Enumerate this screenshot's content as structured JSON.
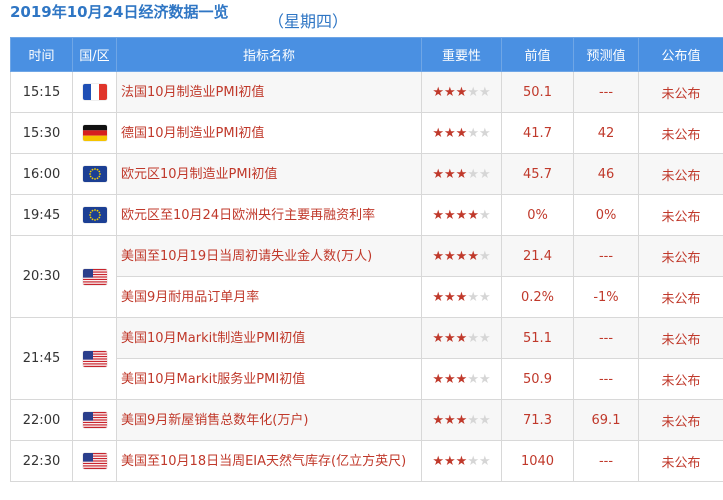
{
  "header": {
    "title": "2019年10月24日经济数据一览",
    "weekday": "（星期四）"
  },
  "columns": [
    "时间",
    "国/区",
    "指标名称",
    "重要性",
    "前值",
    "预测值",
    "公布值"
  ],
  "rows": [
    {
      "time": "15:15",
      "country": "fr",
      "name": "法国10月制造业PMI初值",
      "importance": 3,
      "prev": "50.1",
      "forecast": "---",
      "actual": "未公布"
    },
    {
      "time": "15:30",
      "country": "de",
      "name": "德国10月制造业PMI初值",
      "importance": 3,
      "prev": "41.7",
      "forecast": "42",
      "actual": "未公布"
    },
    {
      "time": "16:00",
      "country": "eu",
      "name": "欧元区10月制造业PMI初值",
      "importance": 3,
      "prev": "45.7",
      "forecast": "46",
      "actual": "未公布"
    },
    {
      "time": "19:45",
      "country": "eu",
      "name": "欧元区至10月24日欧洲央行主要再融资利率",
      "importance": 4,
      "prev": "0%",
      "forecast": "0%",
      "actual": "未公布"
    },
    {
      "time": "20:30",
      "country": "us",
      "name": "美国至10月19日当周初请失业金人数(万人)",
      "importance": 4,
      "prev": "21.4",
      "forecast": "---",
      "actual": "未公布"
    },
    {
      "time": "",
      "country": "",
      "name": "美国9月耐用品订单月率",
      "importance": 3,
      "prev": "0.2%",
      "forecast": "-1%",
      "actual": "未公布"
    },
    {
      "time": "21:45",
      "country": "us",
      "name": "美国10月Markit制造业PMI初值",
      "importance": 3,
      "prev": "51.1",
      "forecast": "---",
      "actual": "未公布"
    },
    {
      "time": "",
      "country": "",
      "name": "美国10月Markit服务业PMI初值",
      "importance": 3,
      "prev": "50.9",
      "forecast": "---",
      "actual": "未公布"
    },
    {
      "time": "22:00",
      "country": "us",
      "name": "美国9月新屋销售总数年化(万户)",
      "importance": 3,
      "prev": "71.3",
      "forecast": "69.1",
      "actual": "未公布"
    },
    {
      "time": "22:30",
      "country": "us",
      "name": "美国至10月18日当周EIA天然气库存(亿立方英尺)",
      "importance": 3,
      "prev": "1040",
      "forecast": "---",
      "actual": "未公布"
    }
  ],
  "colors": {
    "header_bg": "#4a90e2",
    "accent": "#c0392b",
    "title": "#2f76c4"
  }
}
